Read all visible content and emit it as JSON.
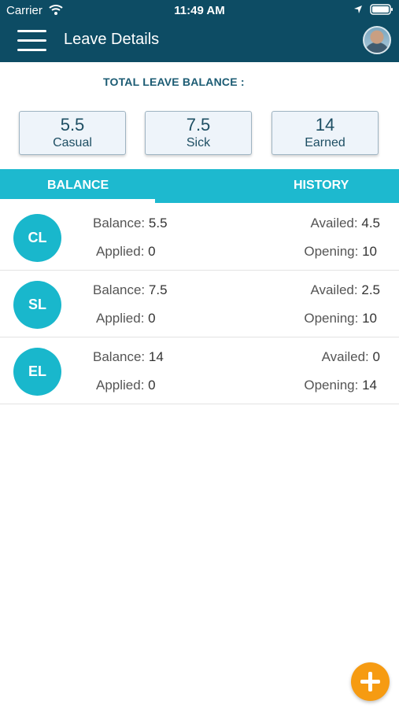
{
  "status_bar": {
    "carrier": "Carrier",
    "time": "11:49 AM"
  },
  "header": {
    "title": "Leave Details"
  },
  "summary": {
    "label": "TOTAL LEAVE BALANCE :",
    "cards": [
      {
        "value": "5.5",
        "label": "Casual"
      },
      {
        "value": "7.5",
        "label": "Sick"
      },
      {
        "value": "14",
        "label": "Earned"
      }
    ]
  },
  "tabs": [
    {
      "label": "BALANCE",
      "active": true
    },
    {
      "label": "HISTORY",
      "active": false
    }
  ],
  "leaves": [
    {
      "code": "CL",
      "balance_label": "Balance:",
      "balance": "5.5",
      "availed_label": "Availed:",
      "availed": "4.5",
      "applied_label": "Applied:",
      "applied": "0",
      "opening_label": "Opening:",
      "opening": "10"
    },
    {
      "code": "SL",
      "balance_label": "Balance:",
      "balance": "7.5",
      "availed_label": "Availed:",
      "availed": "2.5",
      "applied_label": "Applied:",
      "applied": "0",
      "opening_label": "Opening:",
      "opening": "10"
    },
    {
      "code": "EL",
      "balance_label": "Balance:",
      "balance": "14",
      "availed_label": "Availed:",
      "availed": "0",
      "applied_label": "Applied:",
      "applied": "0",
      "opening_label": "Opening:",
      "opening": "14"
    }
  ],
  "colors": {
    "header": "#0d4c64",
    "tab_bar": "#1db9cf",
    "badge": "#19b7cc",
    "fab": "#f69b12"
  },
  "icons": [
    "wifi-icon",
    "location-icon",
    "battery-icon",
    "menu-icon",
    "avatar",
    "add-icon"
  ]
}
